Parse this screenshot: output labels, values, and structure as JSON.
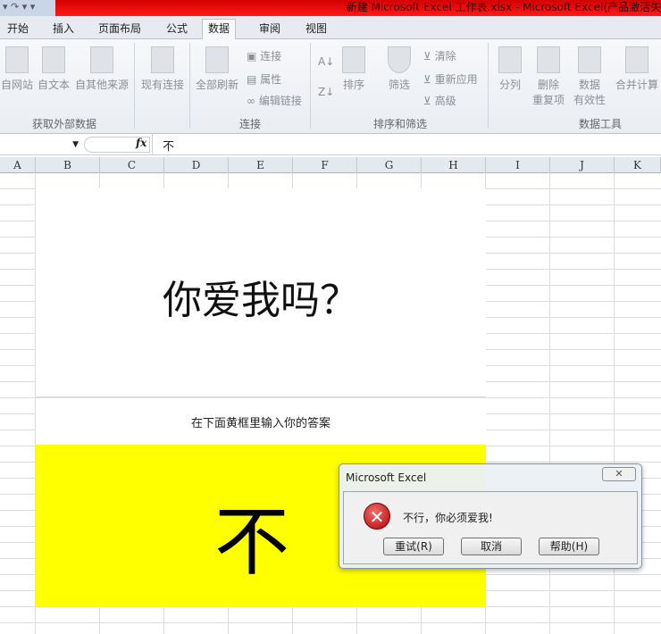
{
  "window": {
    "title": "新建 Microsoft Excel 工作表.xlsx - Microsoft Excel(产品激活失",
    "qat": "▾ ↷ ▾ ▾"
  },
  "tabs": [
    "开始",
    "插入",
    "页面布局",
    "公式",
    "数据",
    "审阅",
    "视图"
  ],
  "active_tab": "数据",
  "ribbon": {
    "get_external": {
      "label": "获取外部数据",
      "buttons": [
        "自网站",
        "自文本",
        "自其他来源",
        "现有连接"
      ]
    },
    "connections": {
      "label": "连接",
      "refresh": "全部刷新",
      "items": [
        "连接",
        "属性",
        "编辑链接"
      ]
    },
    "sort_filter": {
      "label": "排序和筛选",
      "sort": "排序",
      "filter": "筛选",
      "items": [
        "清除",
        "重新应用",
        "高级"
      ]
    },
    "data_tools": {
      "label": "数据工具",
      "split": "分列",
      "dedupe1": "删除",
      "dedupe2": "重复项",
      "valid1": "数据",
      "valid2": "有效性",
      "consolidate": "合并计算"
    }
  },
  "formula_bar": {
    "fx": "fx",
    "value": "不"
  },
  "columns": [
    "A",
    "B",
    "C",
    "D",
    "E",
    "F",
    "G",
    "H",
    "I",
    "J",
    "K"
  ],
  "sheet": {
    "question": "你爱我吗？",
    "hint": "在下面黄框里输入你的答案",
    "answer": "不"
  },
  "dialog": {
    "title": "Microsoft Excel",
    "close": "✕",
    "message": "不行，你必须爱我!",
    "buttons": [
      "重试(R)",
      "取消",
      "帮助(H)"
    ]
  }
}
